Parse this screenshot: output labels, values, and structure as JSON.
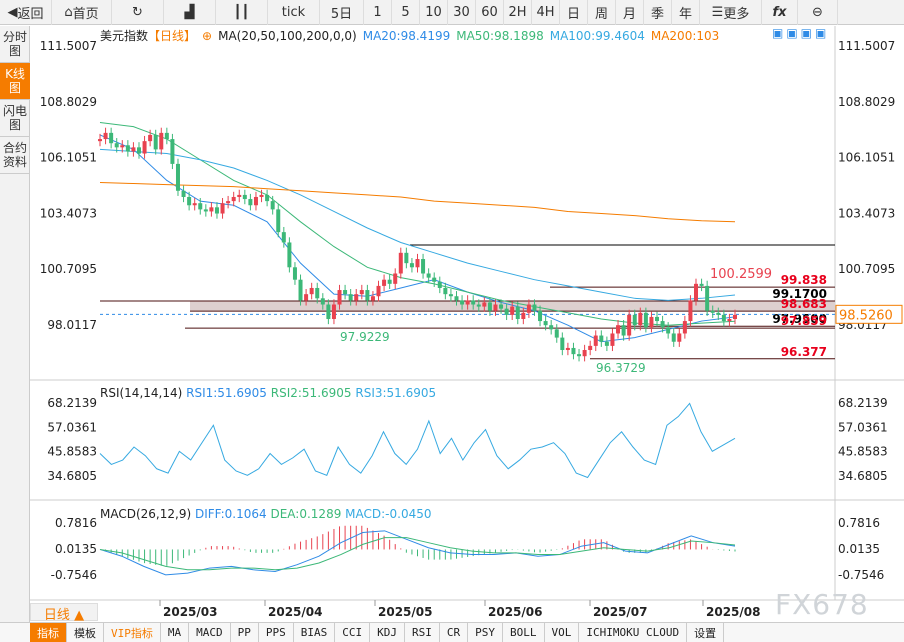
{
  "toolbar": {
    "items": [
      {
        "icon": "back-icon",
        "label": "返回"
      },
      {
        "icon": "home-icon",
        "label": "首页"
      },
      {
        "icon": "refresh-icon",
        "label": ""
      },
      {
        "icon": "bar-chart-icon",
        "label": ""
      },
      {
        "icon": "candlestick-icon",
        "label": ""
      },
      {
        "label": "tick"
      },
      {
        "label": "5日"
      },
      {
        "label": "1"
      },
      {
        "label": "5"
      },
      {
        "label": "10"
      },
      {
        "label": "30"
      },
      {
        "label": "60"
      },
      {
        "label": "2H"
      },
      {
        "label": "4H"
      },
      {
        "label": "日"
      },
      {
        "label": "周"
      },
      {
        "label": "月"
      },
      {
        "label": "季"
      },
      {
        "label": "年"
      },
      {
        "icon": "menu-icon",
        "label": "更多"
      },
      {
        "icon": "function-icon",
        "label": "fx"
      },
      {
        "icon": "zoom-out-icon",
        "label": ""
      }
    ]
  },
  "sidebar": {
    "tabs": [
      {
        "label": "分时图"
      },
      {
        "label": "K线图",
        "active": true
      },
      {
        "label": "闪电图"
      },
      {
        "label": "合约资料"
      }
    ]
  },
  "legend": {
    "title": "美元指数",
    "period": "【日线】",
    "indicator": "MA(20,50,100,200,0,0)",
    "ma20": "MA20:98.4199",
    "ma50": "MA50:98.1898",
    "ma100": "MA100:99.4604",
    "ma200": "MA200:103"
  },
  "colors": {
    "up": "#e8424f",
    "down": "#3cb878",
    "ma20": "#2f8be6",
    "ma50": "#3cb878",
    "ma100": "#36a9e1",
    "ma200": "#f57c00",
    "accent": "#f57c00"
  },
  "rsi_legend": {
    "title": "RSI(14,14,14)",
    "rsi1": "RSI1:51.6905",
    "rsi2": "RSI2:51.6905",
    "rsi3": "RSI3:51.6905"
  },
  "macd_legend": {
    "title": "MACD(26,12,9)",
    "diff": "DIFF:0.1064",
    "dea": "DEA:0.1289",
    "macd": "MACD:-0.0450"
  },
  "chart_data": [
    {
      "type": "candlestick",
      "title": "美元指数",
      "yticks": [
        "111.5007",
        "108.8029",
        "106.1051",
        "103.4073",
        "100.7095",
        "98.0117"
      ],
      "ylim": [
        96.0,
        111.5007
      ],
      "xticks": [
        "2025/03",
        "2025/04",
        "2025/05",
        "2025/06",
        "2025/07",
        "2025/08"
      ],
      "first_open": 106.9,
      "closes": [
        107.0,
        107.3,
        106.8,
        106.6,
        106.7,
        106.4,
        106.6,
        106.3,
        106.9,
        107.2,
        106.5,
        107.3,
        107.0,
        105.8,
        104.5,
        104.2,
        103.8,
        103.9,
        103.6,
        103.5,
        103.7,
        103.4,
        103.9,
        104.0,
        104.2,
        104.3,
        104.1,
        103.8,
        104.2,
        104.3,
        104.0,
        103.6,
        102.5,
        102.0,
        100.8,
        100.2,
        99.2,
        99.5,
        99.8,
        99.3,
        99.0,
        98.3,
        99.0,
        99.7,
        99.5,
        99.2,
        99.5,
        99.7,
        99.2,
        99.4,
        99.9,
        100.2,
        100.0,
        100.5,
        101.5,
        101.0,
        100.8,
        101.2,
        100.5,
        100.3,
        100.1,
        99.8,
        99.5,
        99.4,
        99.2,
        99.0,
        99.2,
        99.0,
        98.9,
        99.1,
        98.7,
        99.0,
        98.8,
        98.5,
        98.9,
        98.3,
        98.6,
        99.0,
        98.7,
        98.2,
        98.0,
        97.8,
        97.4,
        96.8,
        96.9,
        96.6,
        96.5,
        96.8,
        97.0,
        97.5,
        97.2,
        97.0,
        97.6,
        98.0,
        97.5,
        98.5,
        98.0,
        98.6,
        97.9,
        98.4,
        98.2,
        97.9,
        97.6,
        97.2,
        97.6,
        98.2,
        99.2,
        100.0,
        99.9,
        98.7,
        98.6,
        98.5,
        98.2,
        98.3,
        98.5
      ],
      "ma_lines": [
        {
          "name": "MA20",
          "values": [
            107.2,
            106.5,
            105.0,
            104.0,
            103.8,
            103.0,
            101.0,
            99.5,
            99.4,
            99.8,
            100.2,
            99.6,
            99.1,
            98.7,
            98.0,
            97.2,
            97.4,
            97.8,
            98.2,
            98.4
          ]
        },
        {
          "name": "MA50",
          "values": [
            107.8,
            107.6,
            107.0,
            106.0,
            105.0,
            104.3,
            103.0,
            101.8,
            100.8,
            100.3,
            100.0,
            99.6,
            99.2,
            98.9,
            98.6,
            98.3,
            98.1,
            98.0,
            98.1,
            98.19
          ]
        },
        {
          "name": "MA100",
          "values": [
            106.5,
            106.4,
            106.3,
            106.0,
            105.6,
            105.0,
            104.3,
            103.5,
            102.7,
            102.0,
            101.5,
            101.0,
            100.6,
            100.2,
            99.9,
            99.6,
            99.3,
            99.2,
            99.3,
            99.46
          ]
        },
        {
          "name": "MA200",
          "values": [
            104.9,
            104.85,
            104.8,
            104.75,
            104.7,
            104.6,
            104.5,
            104.4,
            104.3,
            104.2,
            104.0,
            103.9,
            103.8,
            103.7,
            103.5,
            103.4,
            103.3,
            103.15,
            103.05,
            103.0
          ]
        }
      ],
      "annotations": {
        "high": "100.2599",
        "low1": "97.9229",
        "low2": "96.3729",
        "levels": [
          {
            "label": "99.838",
            "value": 99.838,
            "color": "#e8001c"
          },
          {
            "label": "99.1700",
            "value": 99.17,
            "color": "#000"
          },
          {
            "label": "98.683",
            "value": 98.683,
            "color": "#e8001c"
          },
          {
            "label": "97.9500",
            "value": 97.95,
            "color": "#000"
          },
          {
            "label": "97.859",
            "value": 97.859,
            "color": "#e8001c"
          },
          {
            "label": "96.377",
            "value": 96.377,
            "color": "#e8001c"
          }
        ],
        "last_price": "98.5260"
      }
    },
    {
      "type": "line",
      "title": "RSI(14,14,14)",
      "yticks": [
        "68.2139",
        "57.0361",
        "45.8583",
        "34.6805"
      ],
      "ylim": [
        34.6805,
        68.2139
      ],
      "values": [
        45,
        40,
        42,
        48,
        44,
        38,
        36,
        46,
        42,
        50,
        58,
        42,
        37,
        35,
        38,
        45,
        40,
        43,
        47,
        37,
        35,
        48,
        40,
        36,
        44,
        55,
        45,
        40,
        47,
        60,
        45,
        52,
        42,
        50,
        56,
        44,
        38,
        42,
        47,
        48,
        50,
        45,
        36,
        34,
        42,
        50,
        55,
        48,
        42,
        40,
        58,
        62,
        68,
        55,
        46,
        49,
        52
      ]
    },
    {
      "type": "bar+line",
      "title": "MACD(26,12,9)",
      "yticks": [
        "0.7816",
        "0.0135",
        "-0.7546"
      ],
      "ylim": [
        -0.7546,
        0.7816
      ],
      "dif": [
        0.0,
        -0.2,
        -0.5,
        -0.75,
        -0.7,
        -0.55,
        -0.5,
        -0.6,
        -0.65,
        -0.45,
        -0.2,
        0.2,
        0.5,
        0.55,
        0.3,
        0.05,
        -0.1,
        -0.15,
        -0.15,
        -0.1,
        -0.2,
        -0.15,
        0.1,
        0.2,
        -0.05,
        -0.1,
        0.15,
        0.4,
        0.2,
        0.1
      ],
      "dea": [
        0.0,
        -0.1,
        -0.3,
        -0.5,
        -0.6,
        -0.6,
        -0.55,
        -0.55,
        -0.6,
        -0.55,
        -0.4,
        -0.15,
        0.15,
        0.35,
        0.35,
        0.2,
        0.05,
        -0.05,
        -0.1,
        -0.1,
        -0.15,
        -0.15,
        -0.05,
        0.05,
        0.0,
        -0.05,
        0.05,
        0.25,
        0.2,
        0.13
      ]
    }
  ],
  "date_selector": "日线",
  "watermark": "FX678",
  "bottom_tabs": [
    {
      "label": "指标",
      "active": true
    },
    {
      "label": "模板"
    },
    {
      "label": "VIP指标",
      "vip": true
    },
    {
      "label": "MA"
    },
    {
      "label": "MACD"
    },
    {
      "label": "PP"
    },
    {
      "label": "PPS"
    },
    {
      "label": "BIAS"
    },
    {
      "label": "CCI"
    },
    {
      "label": "KDJ"
    },
    {
      "label": "RSI"
    },
    {
      "label": "CR"
    },
    {
      "label": "PSY"
    },
    {
      "label": "BOLL"
    },
    {
      "label": "VOL"
    },
    {
      "label": "ICHIMOKU CLOUD"
    },
    {
      "label": "设置"
    }
  ]
}
